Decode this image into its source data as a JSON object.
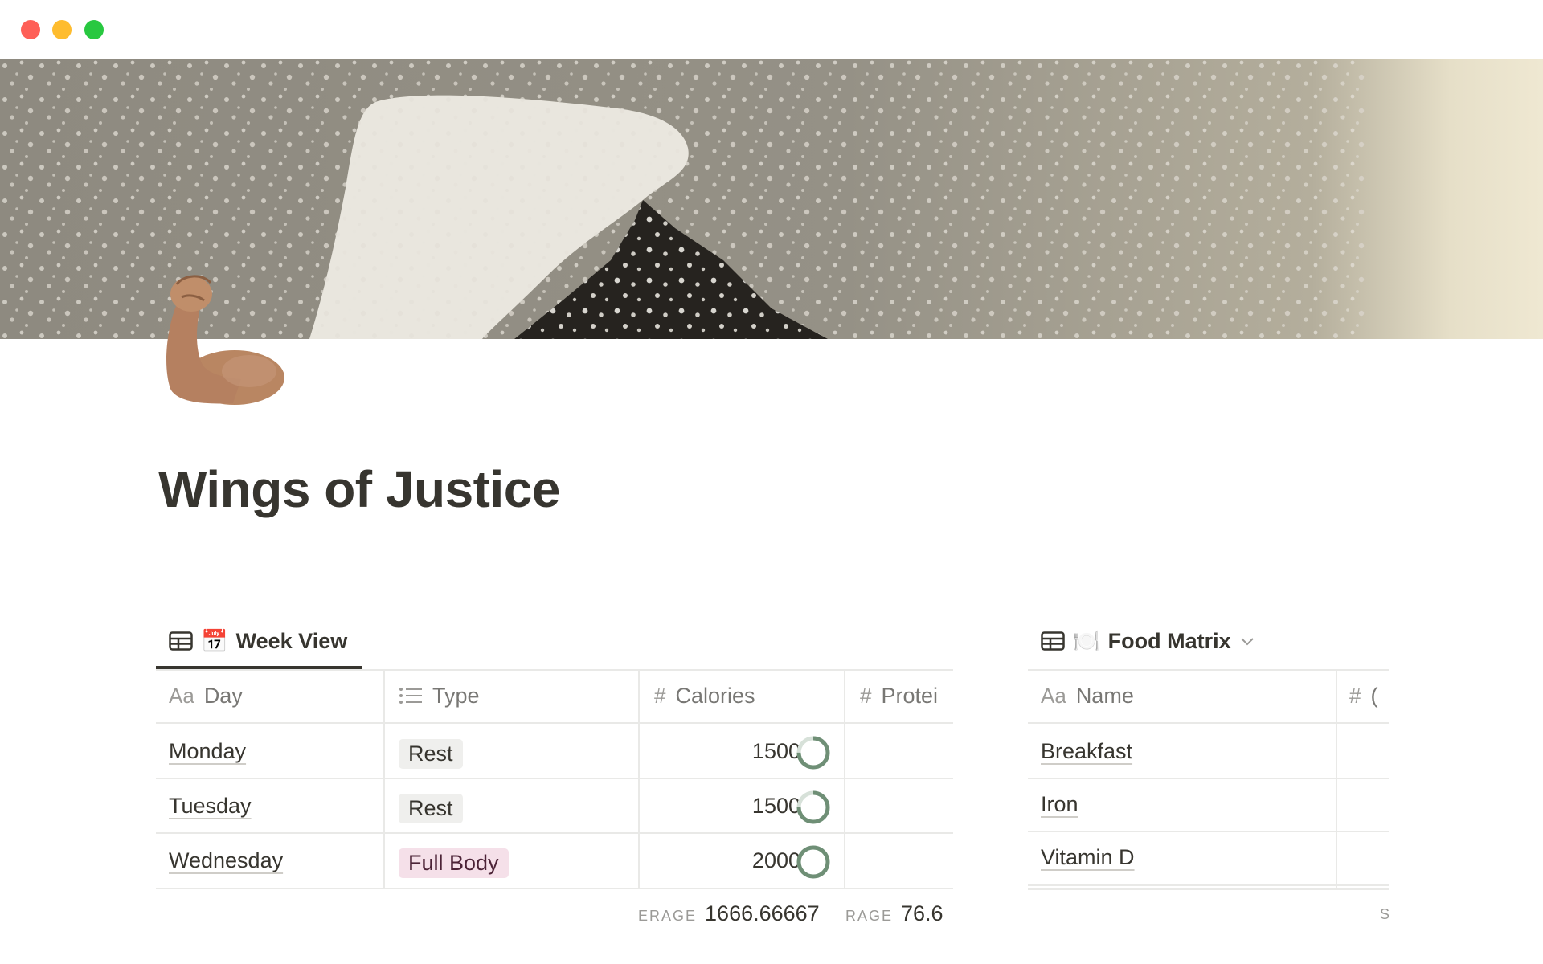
{
  "window": {
    "controls": [
      "close",
      "minimize",
      "zoom"
    ]
  },
  "page": {
    "title": "Wings of Justice",
    "icon": "flexed-biceps-emoji"
  },
  "colors": {
    "text": "#37352f",
    "muted": "#787774",
    "border": "#e9e9e7",
    "tag_rest_bg": "#efefed",
    "tag_full_body_bg": "#f5e0e9",
    "progress_ring": "#6f8f76"
  },
  "week_view": {
    "tab_emoji": "📅",
    "tab_label": "Week View",
    "columns": {
      "day": {
        "prefix": "Aa",
        "label": "Day"
      },
      "type": {
        "icon": "list-icon",
        "label": "Type"
      },
      "calories": {
        "icon": "number-icon",
        "label": "Calories"
      },
      "protein": {
        "icon": "number-icon",
        "label": "Protei"
      }
    },
    "rows": [
      {
        "day": "Monday",
        "type": "Rest",
        "calories": "1500",
        "progress": 0.75
      },
      {
        "day": "Tuesday",
        "type": "Rest",
        "calories": "1500",
        "progress": 0.75
      },
      {
        "day": "Wednesday",
        "type": "Full Body",
        "calories": "2000",
        "progress": 1.0
      }
    ],
    "footer": {
      "calories_label": "ERAGE",
      "calories_value": "1666.66667",
      "protein_label": "RAGE",
      "protein_value": "76.6"
    }
  },
  "food_matrix": {
    "tab_emoji": "🍽️",
    "tab_label": "Food Matrix",
    "columns": {
      "name": {
        "prefix": "Aa",
        "label": "Name"
      },
      "second": {
        "icon": "number-icon",
        "label": "("
      }
    },
    "rows": [
      {
        "name": "Breakfast"
      },
      {
        "name": "Iron"
      },
      {
        "name": "Vitamin D"
      }
    ],
    "footer_fragment": "S"
  }
}
